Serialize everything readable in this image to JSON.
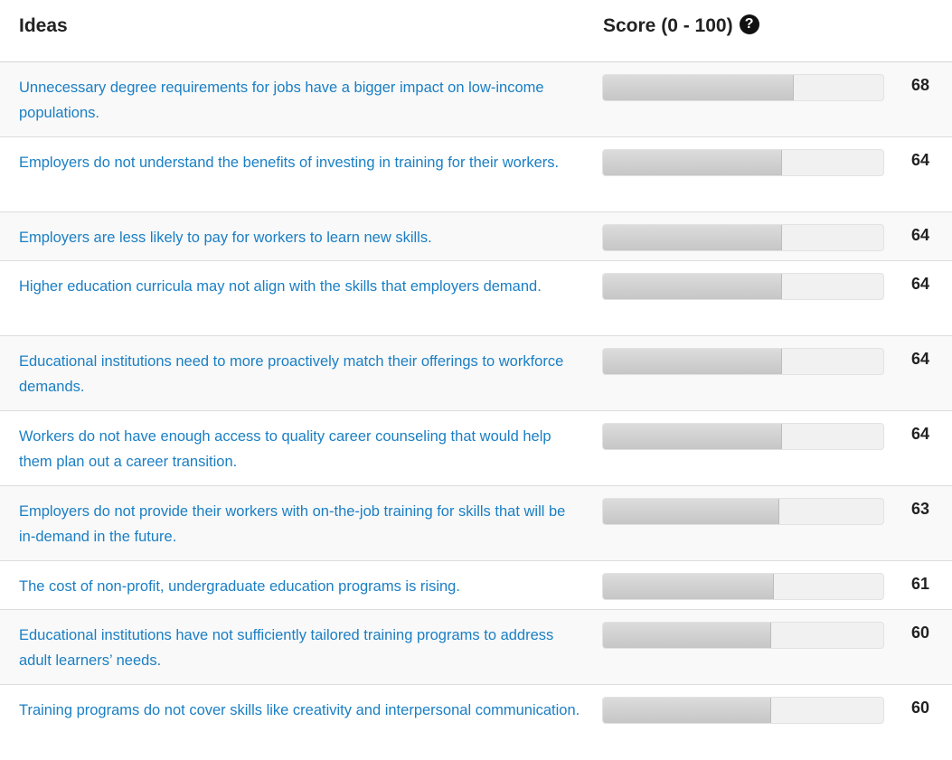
{
  "header": {
    "ideas_label": "Ideas",
    "score_label": "Score (0 - 100)",
    "help_icon": "question-circle-icon",
    "help_glyph": "?"
  },
  "colors": {
    "link": "#1a7fc4",
    "bar_fill": "#c8c8c8",
    "bar_track": "#f1f1f1"
  },
  "score_max": 100,
  "rows": [
    {
      "idea": "Unnecessary degree requirements for jobs have a bigger impact on low-income populations.",
      "score": 68
    },
    {
      "idea": "Employers do not understand the benefits of investing in training for their workers.",
      "score": 64
    },
    {
      "idea": "Employers are less likely to pay for workers to learn new skills.",
      "score": 64
    },
    {
      "idea": "Higher education curricula may not align with the skills that employers demand.",
      "score": 64
    },
    {
      "idea": "Educational institutions need to more proactively match their offerings to workforce demands.",
      "score": 64
    },
    {
      "idea": "Workers do not have enough access to quality career counseling that would help them plan out a career transition.",
      "score": 64
    },
    {
      "idea": "Employers do not provide their workers with on-the-job training for skills that will be in-demand in the future.",
      "score": 63
    },
    {
      "idea": "The cost of non-profit, undergraduate education programs is rising.",
      "score": 61
    },
    {
      "idea": "Educational institutions have not sufficiently tailored training programs to address adult learners’ needs.",
      "score": 60
    },
    {
      "idea": "Training programs do not cover skills like creativity and interpersonal communication.",
      "score": 60
    }
  ]
}
